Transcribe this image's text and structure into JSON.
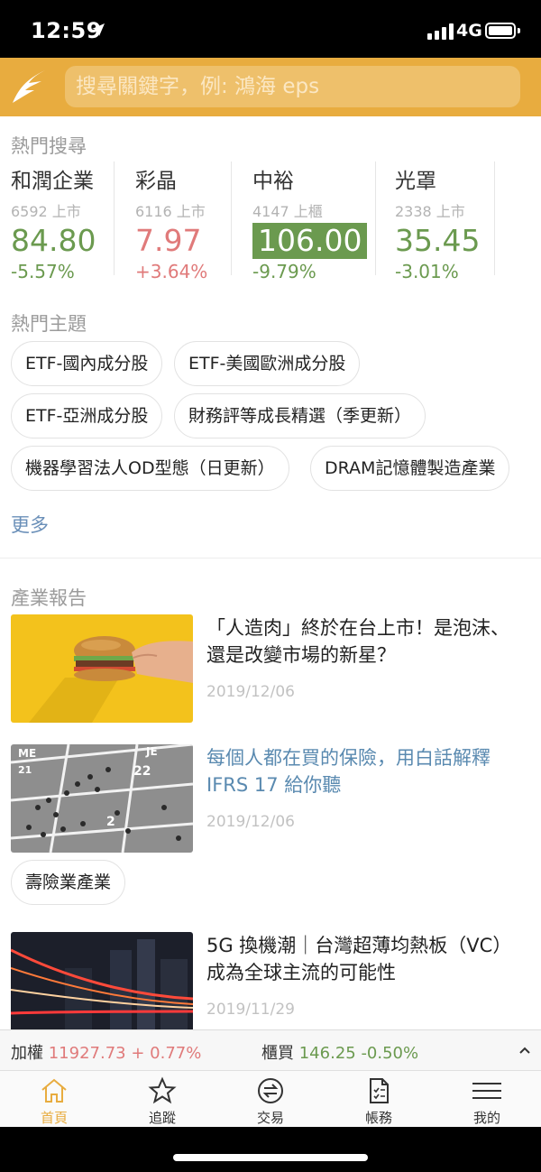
{
  "status": {
    "time": "12:59",
    "network": "4G"
  },
  "search": {
    "placeholder": "搜尋關鍵字，例: 鴻海 eps"
  },
  "hot_search": {
    "title": "熱門搜尋",
    "stocks": [
      {
        "name": "和潤企業",
        "code": "6592 上市",
        "price": "84.80",
        "change": "-5.57%"
      },
      {
        "name": "彩晶",
        "code": "6116 上市",
        "price": "7.97",
        "change": "+3.64%"
      },
      {
        "name": "中裕",
        "code": "4147 上櫃",
        "price": "106.00",
        "change": "-9.79%"
      },
      {
        "name": "光罩",
        "code": "2338 上市",
        "price": "35.45",
        "change": "-3.01%"
      }
    ]
  },
  "hot_topics": {
    "title": "熱門主題",
    "chips": [
      "ETF-國內成分股",
      "ETF-美國歐洲成分股",
      "ETF-亞洲成分股",
      "財務評等成長精選（季更新）",
      "機器學習法人OD型態（日更新）",
      "DRAM記憶體製造產業"
    ],
    "more": "更多"
  },
  "industry_reports": {
    "title": "產業報告",
    "items": [
      {
        "title": "「人造肉」終於在台上市！是泡沫、還是改變市場的新星？",
        "date": "2019/12/06",
        "image": "burger-photo"
      },
      {
        "title": "每個人都在買的保險，用白話解釋IFRS 17 給你聽",
        "date": "2019/12/06",
        "image": "crowd-calendar-photo",
        "tag": "壽險業產業"
      },
      {
        "title": "5G 換機潮｜台灣超薄均熱板（VC） 成為全球主流的可能性",
        "date": "2019/11/29",
        "image": "city-light-trails-photo"
      }
    ]
  },
  "ticker": {
    "items": [
      {
        "label": "加權",
        "value": "11927.73 + 0.77%"
      },
      {
        "label": "櫃買",
        "value": "146.25 -0.50%"
      }
    ]
  },
  "tabs": [
    {
      "label": "首頁",
      "icon": "home-icon",
      "active": true
    },
    {
      "label": "追蹤",
      "icon": "star-icon",
      "active": false
    },
    {
      "label": "交易",
      "icon": "exchange-icon",
      "active": false
    },
    {
      "label": "帳務",
      "icon": "document-icon",
      "active": false
    },
    {
      "label": "我的",
      "icon": "menu-icon",
      "active": false
    }
  ],
  "colors": {
    "brand": "#e8ac3f",
    "up": "#e07a7a",
    "down": "#6b9a4f",
    "link": "#6a8fb8"
  }
}
